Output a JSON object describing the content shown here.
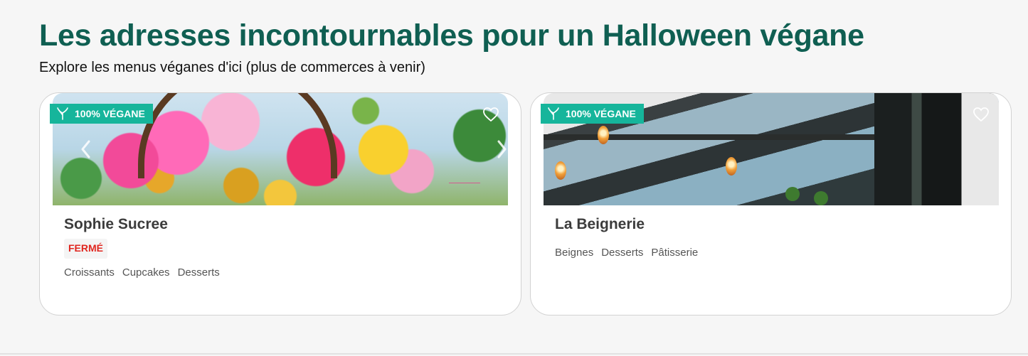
{
  "page": {
    "title": "Les adresses incontournables pour un Halloween végane",
    "subtitle": "Explore les menus véganes d'ici (plus de commerces à venir)"
  },
  "colors": {
    "title": "#0f5f52",
    "badge": "#16b59b",
    "closed": "#e0261f"
  },
  "cards": [
    {
      "name": "Sophie Sucree",
      "badge": "100% VÉGANE",
      "badge_icon": "vegan-sprout-icon",
      "status": "FERMÉ",
      "logo_text": "sophie sucree",
      "tags": [
        "Croissants",
        "Cupcakes",
        "Desserts"
      ]
    },
    {
      "name": "La Beignerie",
      "badge": "100% VÉGANE",
      "badge_icon": "vegan-sprout-icon",
      "tags": [
        "Beignes",
        "Desserts",
        "Pâtisserie"
      ]
    }
  ]
}
